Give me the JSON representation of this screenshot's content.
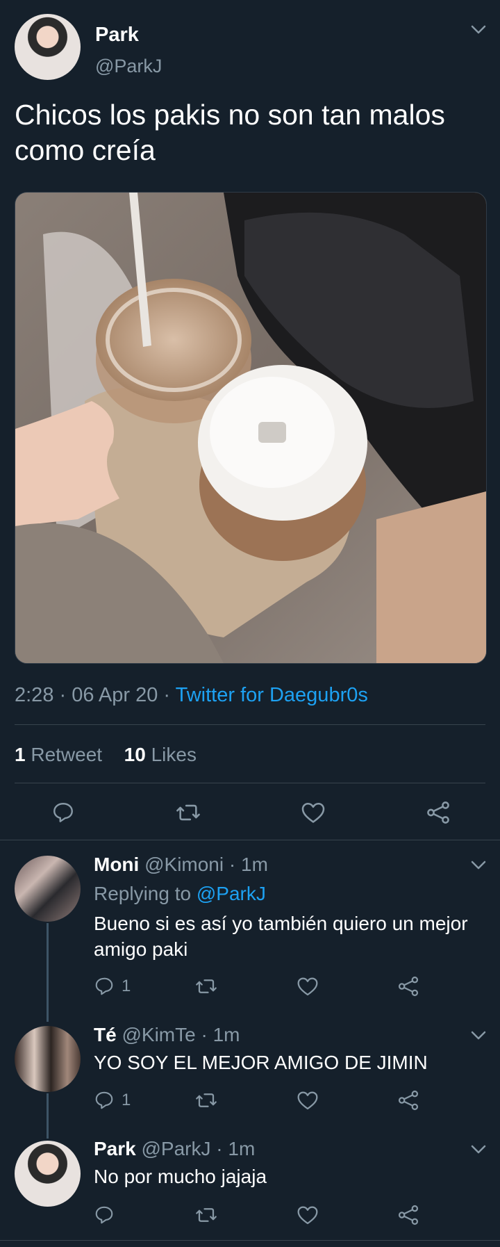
{
  "tweet": {
    "author_name": "Park",
    "author_handle": "@ParkJ",
    "text": "Chicos los pakis no son tan malos como creía",
    "time": "2:28 · 06 Apr 20 · ",
    "source": "Twitter for Daegubr0s",
    "retweet_count": "1",
    "retweet_label": "Retweet",
    "like_count": "10",
    "like_label": "Likes"
  },
  "replies": [
    {
      "name": "Moni",
      "handle": "@Kimoni",
      "time": " · 1m",
      "replying_prefix": "Replying to ",
      "replying_to": "@ParkJ",
      "text": "Bueno si es así yo también quiero un mejor amigo paki",
      "reply_count": "1"
    },
    {
      "name": "Té",
      "handle": "@KimTe",
      "time": " · 1m",
      "text": "YO SOY EL MEJOR AMIGO DE JIMIN",
      "reply_count": "1"
    },
    {
      "name": "Park",
      "handle": "@ParkJ",
      "time": " · 1m",
      "text": "No por mucho jajaja",
      "reply_count": ""
    }
  ],
  "colors": {
    "background": "#15202b",
    "muted": "#8899a6",
    "link": "#1da1f2",
    "divider": "#38444d"
  },
  "icons": [
    "chevron-down-icon",
    "reply-icon",
    "retweet-icon",
    "like-icon",
    "share-icon"
  ]
}
